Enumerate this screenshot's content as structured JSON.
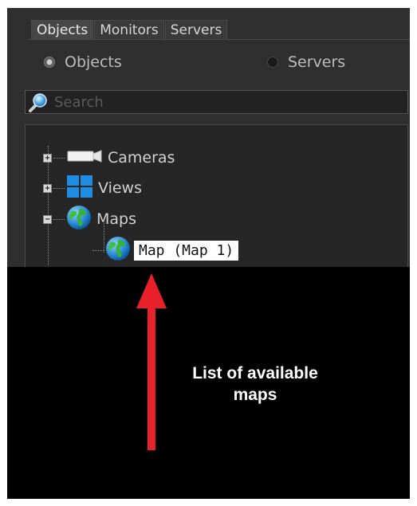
{
  "tabs": [
    {
      "label": "Objects",
      "active": true
    },
    {
      "label": "Monitors",
      "active": false
    },
    {
      "label": "Servers",
      "active": false
    }
  ],
  "radios": {
    "objects": {
      "label": "Objects",
      "checked": true
    },
    "servers": {
      "label": "Servers",
      "checked": false
    }
  },
  "search": {
    "placeholder": "Search",
    "icon": "search-icon"
  },
  "tree": {
    "items": [
      {
        "label": "Cameras",
        "icon": "camera-icon",
        "expander": "+"
      },
      {
        "label": "Views",
        "icon": "views-grid-icon",
        "expander": "+"
      },
      {
        "label": "Maps",
        "icon": "globe-icon",
        "expander": "−"
      },
      {
        "label": "Map (Map 1)",
        "icon": "globe-icon",
        "selected": true
      }
    ]
  },
  "annotation": {
    "caption_line1": "List of available",
    "caption_line2": "maps",
    "arrow_color": "#e8202a"
  },
  "colors": {
    "panel_bg": "#2f2f2f",
    "tree_bg": "#262626",
    "text": "#d2d2d2",
    "selection_bg": "#ffffff"
  }
}
